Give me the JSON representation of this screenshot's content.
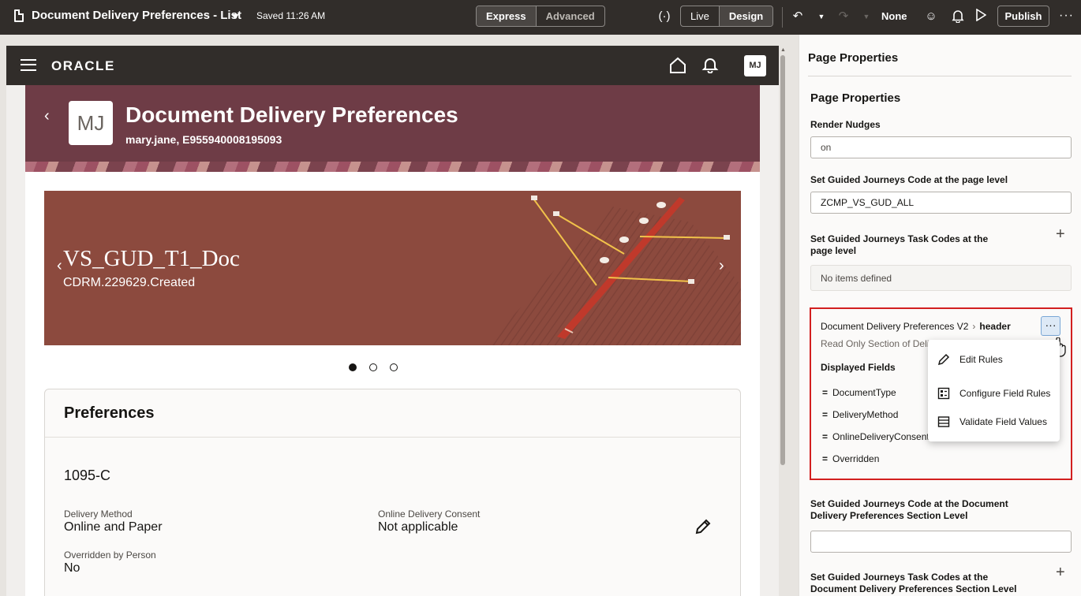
{
  "toolbar": {
    "doc_title": "Document Delivery Preferences - List",
    "saved": "Saved 11:26 AM",
    "mode_express": "Express",
    "mode_advanced": "Advanced",
    "view_live": "Live",
    "view_design": "Design",
    "none_label": "None",
    "publish": "Publish"
  },
  "app": {
    "logo": "ORACLE",
    "user_initials": "MJ"
  },
  "page": {
    "avatar_initials": "MJ",
    "title": "Document Delivery Preferences",
    "subtitle": "mary.jane, E955940008195093"
  },
  "banner": {
    "title": "VS_GUD_T1_Doc",
    "subtitle": "CDRM.229629.Created",
    "slides": 3,
    "active_slide": 1
  },
  "preferences": {
    "heading": "Preferences",
    "item": "1095-C",
    "delivery_method_label": "Delivery Method",
    "delivery_method_value": "Online and Paper",
    "consent_label": "Online Delivery Consent",
    "consent_value": "Not applicable",
    "overridden_label": "Overridden by Person",
    "overridden_value": "No"
  },
  "panel": {
    "header": "Page Properties",
    "section_title": "Page Properties",
    "render_nudges_label": "Render Nudges",
    "render_nudges_value": "on",
    "gj_code_label": "Set Guided Journeys Code at the page level",
    "gj_code_value": "ZCMP_VS_GUD_ALL",
    "gj_task_label": "Set Guided Journeys Task Codes at the page level",
    "gj_task_empty": "No items defined",
    "rules": {
      "crumb_parent": "Document Delivery Preferences V2",
      "crumb_current": "header",
      "description": "Read Only Section of Delivery Preferences",
      "displayed_fields_title": "Displayed Fields",
      "fields": [
        "DocumentType",
        "DeliveryMethod",
        "OnlineDeliveryConsent",
        "Overridden"
      ]
    },
    "section_code_label": "Set Guided Journeys Code at the Document Delivery Preferences Section Level",
    "section_code_value": "",
    "section_task_label": "Set Guided Journeys Task Codes at the Document Delivery Preferences Section Level"
  },
  "menu": {
    "items": [
      "Edit Rules",
      "Configure Field Rules",
      "Validate Field Values"
    ]
  },
  "colors": {
    "toolbar_bg": "#312d2a",
    "page_band": "#6e3c46",
    "banner_bg": "#8c4a3e",
    "highlight_border": "#d21f1f"
  }
}
